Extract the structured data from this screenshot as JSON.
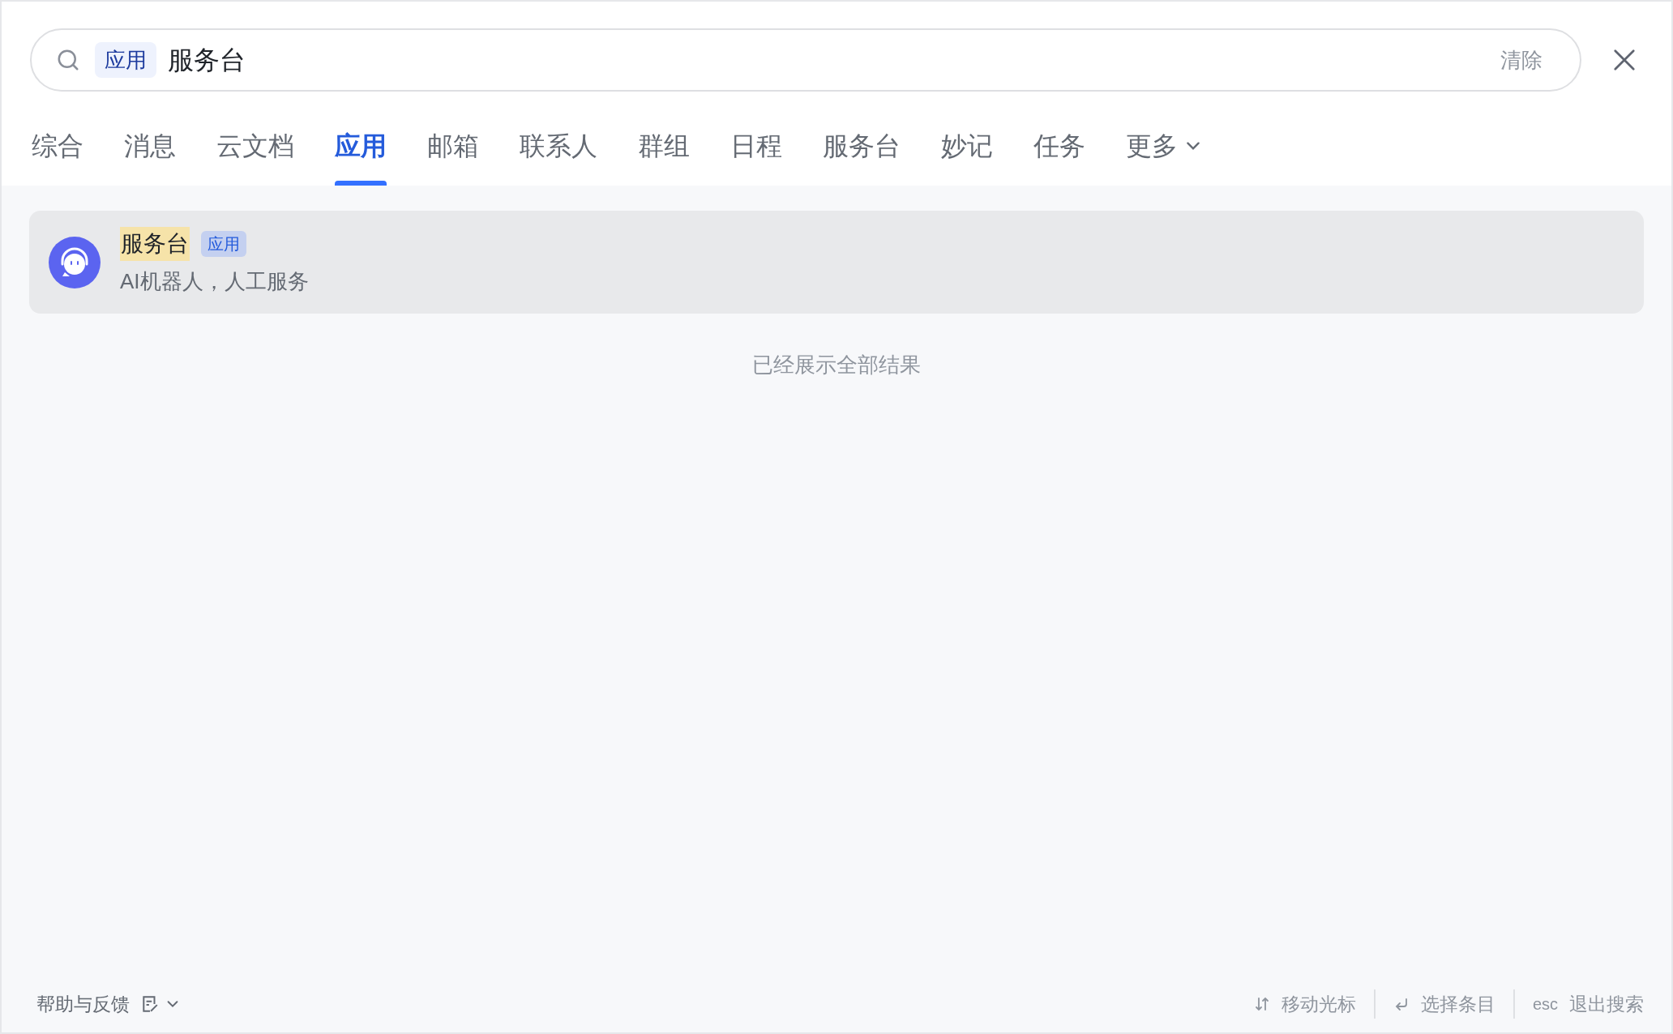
{
  "search": {
    "scope_chip": "应用",
    "query": "服务台",
    "clear": "清除"
  },
  "tabs": [
    {
      "label": "综合",
      "selected": false,
      "kind": "plain"
    },
    {
      "label": "消息",
      "selected": false,
      "kind": "plain"
    },
    {
      "label": "云文档",
      "selected": false,
      "kind": "plain"
    },
    {
      "label": "应用",
      "selected": true,
      "kind": "plain"
    },
    {
      "label": "邮箱",
      "selected": false,
      "kind": "plain"
    },
    {
      "label": "联系人",
      "selected": false,
      "kind": "plain"
    },
    {
      "label": "群组",
      "selected": false,
      "kind": "plain"
    },
    {
      "label": "日程",
      "selected": false,
      "kind": "plain"
    },
    {
      "label": "服务台",
      "selected": false,
      "kind": "plain"
    },
    {
      "label": "妙记",
      "selected": false,
      "kind": "plain"
    },
    {
      "label": "任务",
      "selected": false,
      "kind": "plain"
    },
    {
      "label": "更多",
      "selected": false,
      "kind": "menu"
    }
  ],
  "results": [
    {
      "title": "服务台",
      "highlighted": true,
      "badge": "应用",
      "description": "AI机器人，人工服务",
      "selected": true
    }
  ],
  "end_message": "已经展示全部结果",
  "footer": {
    "help": "帮助与反馈",
    "hints": [
      {
        "kind": "updown",
        "label": "移动光标"
      },
      {
        "kind": "enter",
        "label": "选择条目"
      },
      {
        "kind": "text",
        "key": "esc",
        "label": "退出搜索"
      }
    ]
  }
}
